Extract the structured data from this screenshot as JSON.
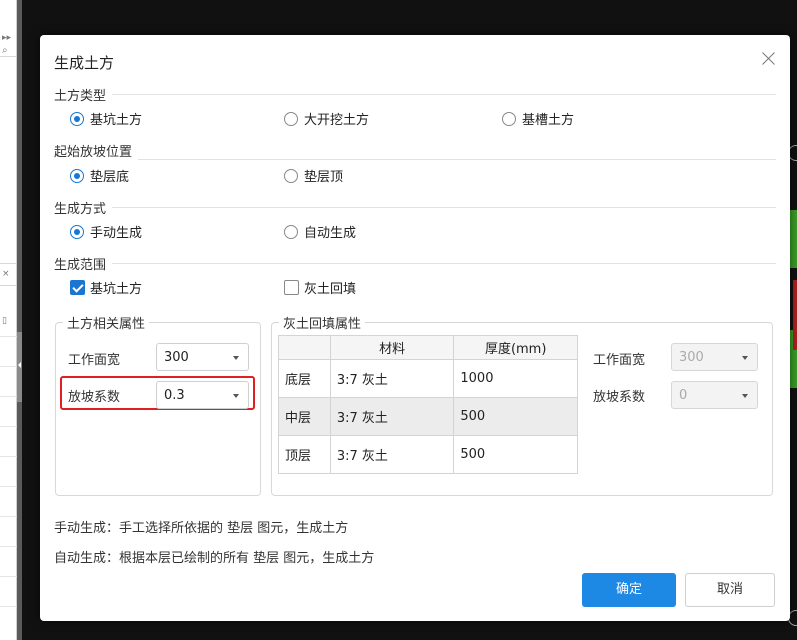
{
  "background_app": {
    "left_panel_glyphs": [
      "▸▸",
      "⌕",
      "×",
      "▯"
    ]
  },
  "dialog": {
    "title": "生成土方",
    "earthwork_type": {
      "label": "土方类型",
      "options": [
        "基坑土方",
        "大开挖土方",
        "基槽土方"
      ],
      "selected": "基坑土方"
    },
    "slope_start": {
      "label": "起始放坡位置",
      "options": [
        "垫层底",
        "垫层顶"
      ],
      "selected": "垫层底"
    },
    "generation_method": {
      "label": "生成方式",
      "options": [
        "手动生成",
        "自动生成"
      ],
      "selected": "手动生成"
    },
    "generation_scope": {
      "label": "生成范围",
      "options": [
        {
          "label": "基坑土方",
          "checked": true
        },
        {
          "label": "灰土回填",
          "checked": false
        }
      ]
    },
    "earthwork_props": {
      "title": "土方相关属性",
      "work_width_label": "工作面宽",
      "work_width_value": "300",
      "slope_coef_label": "放坡系数",
      "slope_coef_value": "0.3"
    },
    "backfill_props": {
      "title": "灰土回填属性",
      "columns": [
        "",
        "材料",
        "厚度(mm)"
      ],
      "rows": [
        {
          "layer": "底层",
          "material": "3:7 灰土",
          "thickness": "1000"
        },
        {
          "layer": "中层",
          "material": "3:7 灰土",
          "thickness": "500"
        },
        {
          "layer": "顶层",
          "material": "3:7 灰土",
          "thickness": "500"
        }
      ],
      "work_width_label": "工作面宽",
      "work_width_value": "300",
      "slope_coef_label": "放坡系数",
      "slope_coef_value": "0"
    },
    "notes": [
      "手动生成：手工选择所依据的 垫层 图元，生成土方",
      "自动生成：根据本层已绘制的所有 垫层 图元，生成土方"
    ],
    "buttons": {
      "ok": "确定",
      "cancel": "取消"
    }
  },
  "colors": {
    "accent": "#1e88e5",
    "highlight": "#e02020"
  }
}
